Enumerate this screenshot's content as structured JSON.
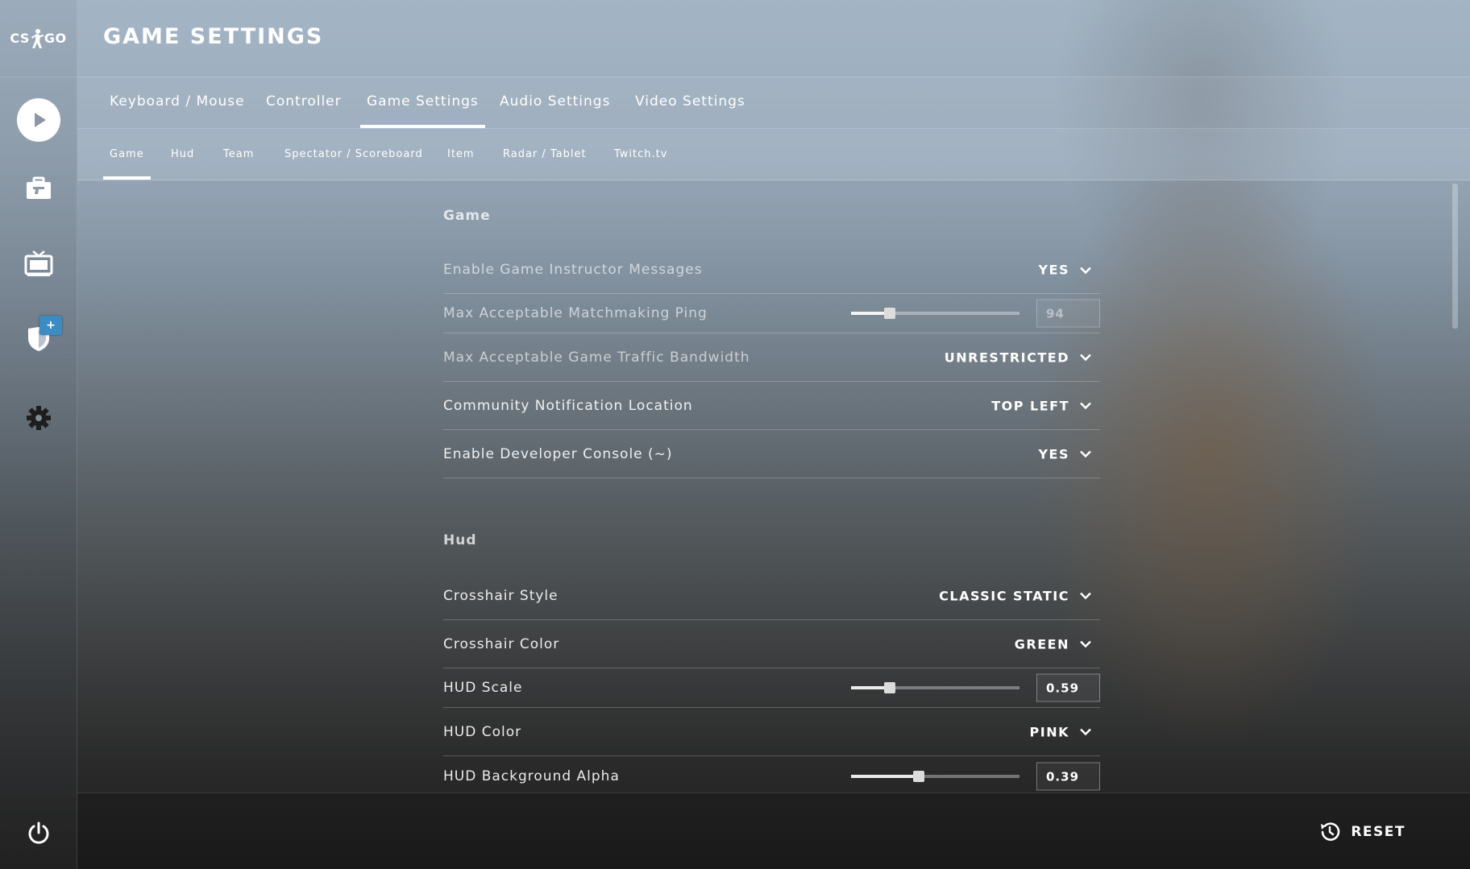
{
  "logo": {
    "left": "CS",
    "right": "GO"
  },
  "sidebar": {
    "items": [
      {
        "name": "play",
        "icon": "play-icon"
      },
      {
        "name": "inventory",
        "icon": "briefcase-icon"
      },
      {
        "name": "watch",
        "icon": "tv-icon"
      },
      {
        "name": "profile",
        "icon": "shield-icon",
        "badge": "+"
      },
      {
        "name": "settings",
        "icon": "gear-icon"
      }
    ],
    "power_icon": "power-icon"
  },
  "header": {
    "title": "GAME SETTINGS"
  },
  "tabs": [
    {
      "label": "Keyboard / Mouse",
      "active": false
    },
    {
      "label": "Controller",
      "active": false
    },
    {
      "label": "Game Settings",
      "active": true
    },
    {
      "label": "Audio Settings",
      "active": false
    },
    {
      "label": "Video Settings",
      "active": false
    }
  ],
  "subtabs": [
    {
      "label": "Game",
      "active": true
    },
    {
      "label": "Hud",
      "active": false
    },
    {
      "label": "Team",
      "active": false
    },
    {
      "label": "Spectator / Scoreboard",
      "active": false
    },
    {
      "label": "Item",
      "active": false
    },
    {
      "label": "Radar / Tablet",
      "active": false
    },
    {
      "label": "Twitch.tv",
      "active": false
    }
  ],
  "sections": [
    {
      "title": "Game",
      "rows": [
        {
          "label": "Enable Game Instructor Messages",
          "type": "dropdown",
          "value": "YES"
        },
        {
          "label": "Max Acceptable Matchmaking Ping",
          "type": "slider",
          "value": "94",
          "fraction": 0.23
        },
        {
          "label": "Max Acceptable Game Traffic Bandwidth",
          "type": "dropdown",
          "value": "UNRESTRICTED"
        },
        {
          "label": "Community Notification Location",
          "type": "dropdown",
          "value": "TOP LEFT"
        },
        {
          "label": "Enable Developer Console (~)",
          "type": "dropdown",
          "value": "YES"
        }
      ]
    },
    {
      "title": "Hud",
      "rows": [
        {
          "label": "Crosshair Style",
          "type": "dropdown",
          "value": "CLASSIC STATIC"
        },
        {
          "label": "Crosshair Color",
          "type": "dropdown",
          "value": "GREEN"
        },
        {
          "label": "HUD Scale",
          "type": "slider",
          "value": "0.59",
          "fraction": 0.23
        },
        {
          "label": "HUD Color",
          "type": "dropdown",
          "value": "PINK"
        },
        {
          "label": "HUD Background Alpha",
          "type": "slider",
          "value": "0.39",
          "fraction": 0.4
        }
      ]
    }
  ],
  "footer": {
    "reset_label": "RESET"
  },
  "colors": {
    "badge": "#3a8dc4",
    "text": "#ffffff"
  }
}
